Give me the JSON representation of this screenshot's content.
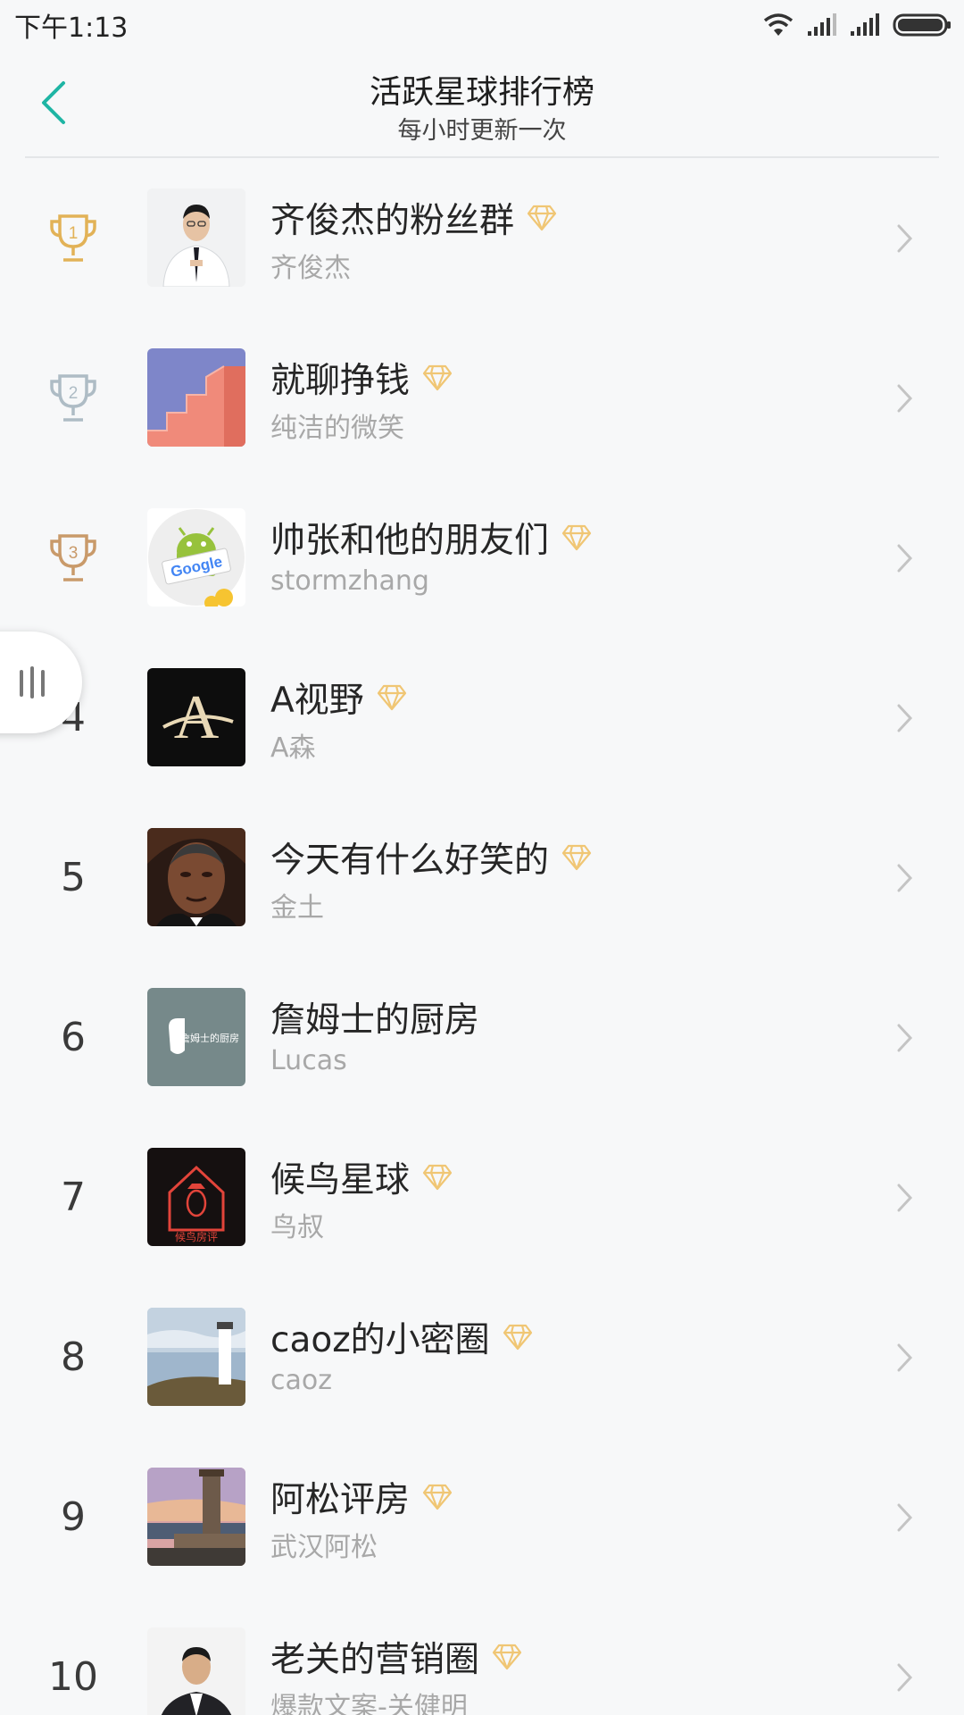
{
  "status_bar": {
    "time": "下午1:13",
    "icons": [
      "wifi-icon",
      "signal-icon",
      "signal-icon",
      "battery-icon"
    ]
  },
  "header": {
    "title": "活跃星球排行榜",
    "subtitle": "每小时更新一次",
    "back_icon": "chevron-left-icon"
  },
  "colors": {
    "accent": "#1fb5a4",
    "gold": "#e2b257",
    "silver": "#aebcc5",
    "bronze": "#c99a6a",
    "diamond": "#f0c674",
    "text_primary": "#262626",
    "text_secondary": "#a8a8a8",
    "background": "#f7f8f9"
  },
  "rankings": [
    {
      "rank": "1",
      "trophy": "gold",
      "title": "齐俊杰的粉丝群",
      "owner": "齐俊杰",
      "diamond": true
    },
    {
      "rank": "2",
      "trophy": "silver",
      "title": "就聊挣钱",
      "owner": "纯洁的微笑",
      "diamond": true
    },
    {
      "rank": "3",
      "trophy": "bronze",
      "title": "帅张和他的朋友们",
      "owner": "stormzhang",
      "diamond": true
    },
    {
      "rank": "4",
      "title": "A视野",
      "owner": "A森",
      "diamond": true
    },
    {
      "rank": "5",
      "title": "今天有什么好笑的",
      "owner": "金土",
      "diamond": true
    },
    {
      "rank": "6",
      "title": "詹姆士的厨房",
      "owner": "Lucas",
      "diamond": false
    },
    {
      "rank": "7",
      "title": "候鸟星球",
      "owner": "鸟叔",
      "diamond": true
    },
    {
      "rank": "8",
      "title": "caoz的小密圈",
      "owner": "caoz",
      "diamond": true
    },
    {
      "rank": "9",
      "title": "阿松评房",
      "owner": "武汉阿松",
      "diamond": true
    },
    {
      "rank": "10",
      "title": "老关的营销圈",
      "owner": "爆款文案-关健明",
      "diamond": true
    }
  ],
  "avatar_labels": {
    "google": "Google",
    "a_letter": "A",
    "kitchen": "詹姆士的厨房",
    "bird": "候鸟房评"
  }
}
